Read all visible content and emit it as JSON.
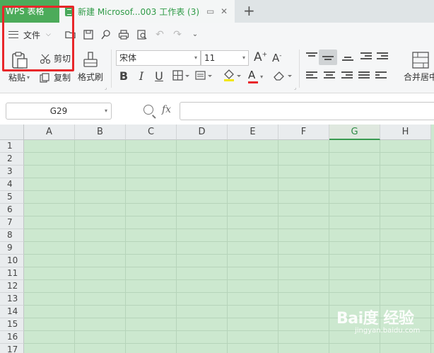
{
  "tabs": {
    "app_tab": "WPS 表格",
    "doc_tab": "新建 Microsof...003 工作表 (3)"
  },
  "ribbon": {
    "file_menu": "文件",
    "paste_label": "粘贴",
    "cut_label": "剪切",
    "copy_label": "复制",
    "format_painter_label": "格式刷",
    "font_name": "宋体",
    "font_size": "11",
    "merge_center_label": "合并居中",
    "bold": "B",
    "italic": "I",
    "underline": "U",
    "font_color_letter": "A",
    "font_grow": "A",
    "font_shrink": "A"
  },
  "formula_bar": {
    "cell_ref": "G29",
    "fx_label": "fx",
    "formula_value": ""
  },
  "grid": {
    "columns": [
      "A",
      "B",
      "C",
      "D",
      "E",
      "F",
      "G",
      "H"
    ],
    "active_column": "G",
    "rows": [
      "1",
      "2",
      "3",
      "4",
      "5",
      "6",
      "7",
      "8",
      "9",
      "10",
      "11",
      "12",
      "13",
      "14",
      "15",
      "16",
      "17"
    ]
  },
  "watermark": {
    "main": "Bai度 经验",
    "sub": "jingyan.baidu.com"
  },
  "colors": {
    "app_tab": "#4cab5a",
    "sheet_bg": "#cce8cf",
    "highlight_box": "#e8272a",
    "font_color_underline": "#e8272a",
    "fill_color_underline": "#f2e600"
  }
}
